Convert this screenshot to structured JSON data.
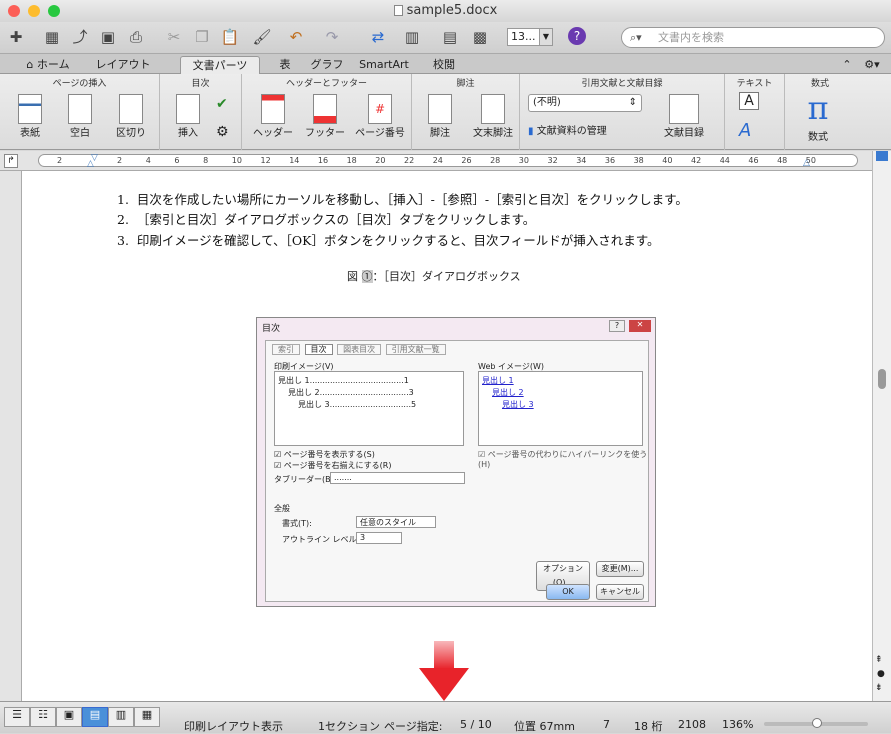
{
  "window": {
    "title": "sample5.docx"
  },
  "toolbar": {
    "zoom_value": "13...",
    "search_placeholder": "文書内を検索"
  },
  "tabs": [
    {
      "label": "ホーム"
    },
    {
      "label": "レイアウト"
    },
    {
      "label": "文書パーツ"
    },
    {
      "label": "表"
    },
    {
      "label": "グラフ"
    },
    {
      "label": "SmartArt"
    },
    {
      "label": "校閲"
    }
  ],
  "ribbon": {
    "groups": [
      {
        "title": "ページの挿入"
      },
      {
        "title": "目次"
      },
      {
        "title": "ヘッダーとフッター"
      },
      {
        "title": "脚注"
      },
      {
        "title": "引用文献と文献目録"
      },
      {
        "title": "テキスト"
      },
      {
        "title": "数式"
      }
    ],
    "buttons": {
      "cover": "表紙",
      "blank": "空白",
      "break": "区切り",
      "toc_insert": "挿入",
      "header": "ヘッダー",
      "footer": "フッター",
      "page_number": "ページ番号",
      "footnote": "脚注",
      "endnote": "文末脚注",
      "citation_style": "(不明)",
      "source_manager": "文献資料の管理",
      "bibliography": "文献目録",
      "equation": "数式"
    }
  },
  "ruler": {
    "ticks": [
      "2",
      "2",
      "4",
      "6",
      "8",
      "10",
      "12",
      "14",
      "16",
      "18",
      "20",
      "22",
      "24",
      "26",
      "28",
      "30",
      "32",
      "34",
      "36",
      "38",
      "40",
      "42",
      "44",
      "46",
      "48",
      "50"
    ]
  },
  "document": {
    "items": [
      {
        "num": "1.",
        "text": "目次を作成したい場所にカーソルを移動し、［挿入］-［参照］-［索引と目次］をクリックします。"
      },
      {
        "num": "2.",
        "text": "［索引と目次］ダイアログボックスの［目次］タブをクリックします。"
      },
      {
        "num": "3.",
        "text": "印刷イメージを確認して、［OK］ボタンをクリックすると、目次フィールドが挿入されます。"
      }
    ],
    "caption_prefix": "図",
    "caption_num": "①",
    "caption_text": "：［目次］ダイアログボックス"
  },
  "dialog": {
    "title": "目次",
    "tabs": [
      "索引",
      "目次",
      "図表目次",
      "引用文献一覧"
    ],
    "print_label": "印刷イメージ(V)",
    "print_lines": [
      "見出し 1.....................................1",
      "見出し 2...................................3",
      "見出し 3................................5"
    ],
    "web_label": "Web イメージ(W)",
    "web_lines": [
      "見出し 1",
      "見出し 2",
      "見出し 3"
    ],
    "chk_page": "ページ番号を表示する(S)",
    "chk_right": "ページ番号を右揃えにする(R)",
    "chk_hyper": "ページ番号の代わりにハイパーリンクを使う(H)",
    "leader_label": "タブリーダー(B):",
    "leader_value": ".......",
    "general": "全般",
    "format_label": "書式(T):",
    "format_value": "任意のスタイル",
    "level_label": "アウトライン レベル(L):",
    "level_value": "3",
    "options_btn": "オプション(O)...",
    "modify_btn": "変更(M)...",
    "ok_btn": "OK",
    "cancel_btn": "キャンセル"
  },
  "status": {
    "view": "印刷レイアウト表示",
    "section": "1セクション",
    "page_label": "ページ指定:",
    "page_value": "5 / 10",
    "position": "位置 67mm",
    "line": "7",
    "col": "18 桁",
    "words": "2108",
    "zoom": "136%"
  },
  "colors": {
    "arrow": "#e8232a",
    "accent": "#4a90d9"
  }
}
